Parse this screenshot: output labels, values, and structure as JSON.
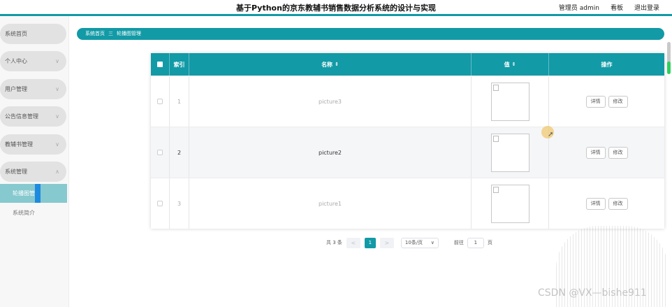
{
  "header": {
    "title": "基于Python的京东教辅书销售数据分析系统的设计与实现",
    "nav": [
      "管理员 admin",
      "看板",
      "退出登录"
    ]
  },
  "sidebar": {
    "items": [
      {
        "label": "系统首页",
        "chevron": false
      },
      {
        "label": "个人中心",
        "chevron": true
      },
      {
        "label": "用户管理",
        "chevron": true
      },
      {
        "label": "公告信息管理",
        "chevron": true
      },
      {
        "label": "教辅书管理",
        "chevron": true
      },
      {
        "label": "系统管理",
        "chevron": true
      }
    ],
    "subitems": [
      {
        "label": "轮播图管理",
        "active": true
      },
      {
        "label": "系统简介",
        "active": false
      }
    ]
  },
  "breadcrumb": {
    "home": "系统首页",
    "separator": "三",
    "current": "轮播图管理"
  },
  "table": {
    "headers": {
      "index": "索引",
      "name": "名称",
      "value": "值",
      "actions": "操作"
    },
    "sort_icon": "⇕",
    "rows": [
      {
        "index": "1",
        "name": "picture3"
      },
      {
        "index": "2",
        "name": "picture2"
      },
      {
        "index": "3",
        "name": "picture1"
      }
    ],
    "detail_label": "详情",
    "edit_label": "修改"
  },
  "pagination": {
    "total": "共 3 条",
    "prev": "<",
    "current": "1",
    "next": ">",
    "page_size": "10条/页",
    "goto_label": "前往",
    "goto_value": "1",
    "page_unit": "页"
  },
  "watermark": "CSDN @VX—bishe911",
  "colors": {
    "accent": "#129aa6",
    "active_sub": "#86c9cf",
    "highlight_bar": "#1e8be0"
  }
}
